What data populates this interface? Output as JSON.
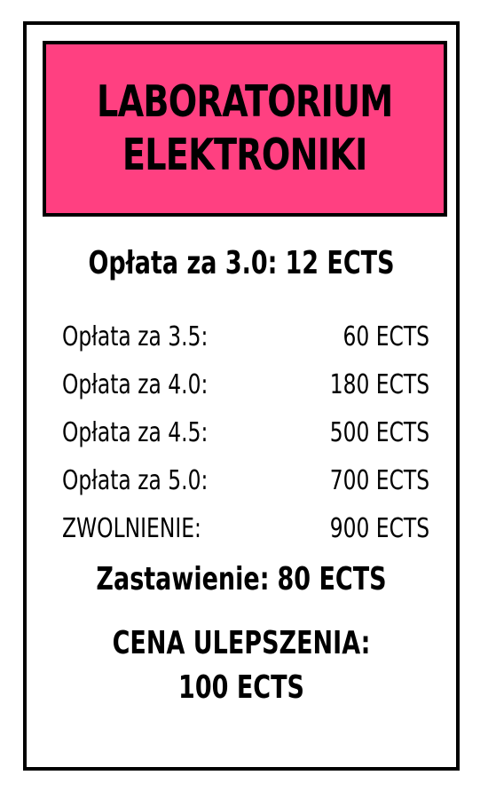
{
  "card": {
    "title_lines": [
      "LABORATORIUM",
      "ELEKTRONIKI"
    ],
    "title_color": "#ff4081",
    "rent": {
      "label": "Opłata za 3.0:",
      "value": "12 ECTS"
    },
    "rent_levels": [
      {
        "label": "Opłata za 3.5:",
        "value": "60 ECTS"
      },
      {
        "label": "Opłata za 4.0:",
        "value": "180 ECTS"
      },
      {
        "label": "Opłata za 4.5:",
        "value": "500 ECTS"
      },
      {
        "label": "Opłata za 5.0:",
        "value": "700 ECTS"
      },
      {
        "label": "ZWOLNIENIE:",
        "value": "900 ECTS"
      }
    ],
    "mortgage": {
      "label": "Zastawienie:",
      "value": "80 ECTS"
    },
    "upgrade": {
      "label": "CENA ULEPSZENIA:",
      "value": "100 ECTS"
    }
  }
}
